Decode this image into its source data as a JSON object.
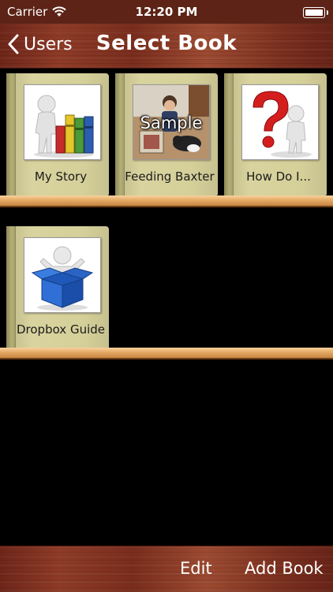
{
  "status_bar": {
    "carrier": "Carrier",
    "time": "12:20 PM"
  },
  "nav": {
    "back_label": "Users",
    "title": "Select Book"
  },
  "books": [
    {
      "title": "My Story",
      "cover": "person-with-books"
    },
    {
      "title": "Feeding Baxter",
      "cover": "photo-child-with-dog",
      "overlay": "Sample"
    },
    {
      "title": "How Do I...",
      "cover": "person-question-mark"
    },
    {
      "title": "Dropbox Guide",
      "cover": "person-in-box"
    }
  ],
  "toolbar": {
    "edit_label": "Edit",
    "add_book_label": "Add Book"
  },
  "colors": {
    "wood": "#7a2d1d",
    "shelf": "#e5a964",
    "book": "#d5cf99",
    "background": "#000000"
  }
}
